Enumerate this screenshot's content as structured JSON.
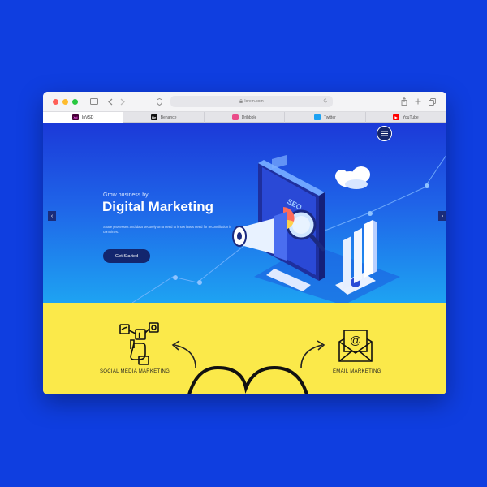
{
  "browser": {
    "url": "lorem.com",
    "tabs": [
      {
        "label": "InVSD",
        "icon": "xd-icon",
        "color": "#470137",
        "glyph": "Xd"
      },
      {
        "label": "Behance",
        "icon": "behance-icon",
        "color": "#111111",
        "glyph": "Be"
      },
      {
        "label": "Dribbble",
        "icon": "dribbble-icon",
        "color": "#ea4c89",
        "glyph": ""
      },
      {
        "label": "Twitter",
        "icon": "twitter-icon",
        "color": "#1da1f2",
        "glyph": ""
      },
      {
        "label": "YouTube",
        "icon": "youtube-icon",
        "color": "#ff0000",
        "glyph": "▶"
      }
    ]
  },
  "hero": {
    "subtitle": "Grow business by",
    "title": "Digital Marketing",
    "description": "Share processes and data securely on a need to know basis need for reconciliation it combines.",
    "cta_label": "Get Started",
    "seo_label": "SEO"
  },
  "services": {
    "items": [
      {
        "label": "SOCIAL MEDIA MARKETING",
        "icon": "social-media-icon"
      },
      {
        "label": "EMAIL MARKETING",
        "icon": "email-icon"
      }
    ]
  },
  "colors": {
    "page_bg": "#0f3ee0",
    "hero_top": "#1b39d8",
    "hero_bottom": "#1ea3f2",
    "services_bg": "#fbe94a",
    "cta_bg": "#13266e"
  }
}
